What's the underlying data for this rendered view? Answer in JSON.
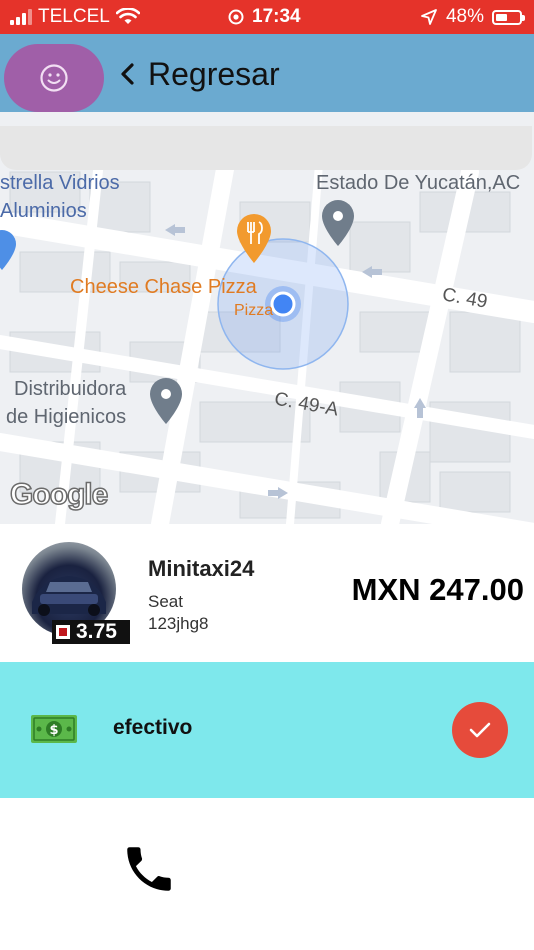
{
  "status_bar": {
    "carrier": "TELCEL",
    "time": "17:34",
    "battery": "48%",
    "battery_level": 0.48
  },
  "header": {
    "back_label": "Regresar"
  },
  "map": {
    "labels": {
      "estrella": "strella Vidrios",
      "aluminios": "Aluminios",
      "estado": "Estado De Yucatán,AC",
      "cheese_chase": "Cheese Chase Pizza",
      "pizza": "Pizza",
      "c49": "C. 49",
      "distribuidora": "Distribuidora",
      "higienicos": "de Higienicos",
      "c49a": "C. 49-A",
      "google": "Google"
    }
  },
  "driver": {
    "name": "Minitaxi24",
    "car": "Seat",
    "plate": "123jhg8",
    "rating": "3.75",
    "price": "MXN 247.00"
  },
  "payment": {
    "method": "efectivo"
  },
  "colors": {
    "status_bar": "#e5332a",
    "header": "#6baad0",
    "fab": "#a05fa8",
    "payment_bg": "#7ee8ec",
    "check_button": "#e64b3b"
  },
  "icons": {
    "fab": "smiley-icon",
    "back": "chevron-left-icon",
    "payment": "cash-icon",
    "confirm": "check-icon",
    "call": "phone-icon"
  }
}
